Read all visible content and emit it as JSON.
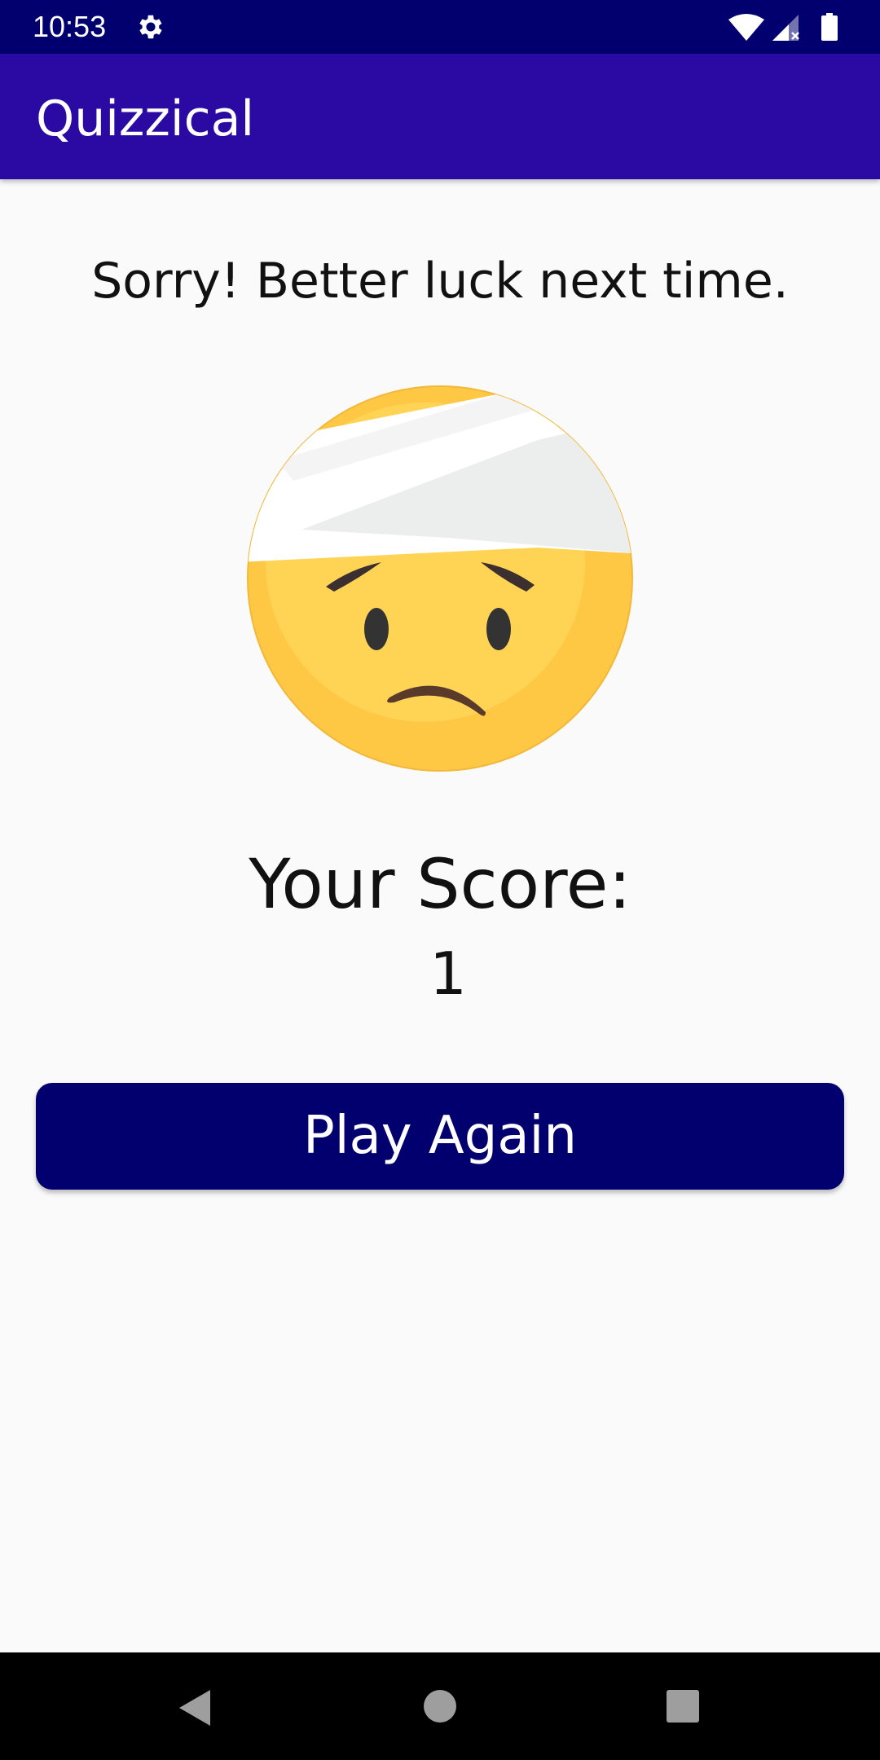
{
  "status_bar": {
    "time": "10:53",
    "icons": [
      "gear-icon",
      "wifi-icon",
      "signal-icon",
      "battery-icon"
    ]
  },
  "app_bar": {
    "title": "Quizzical"
  },
  "result": {
    "message": "Sorry! Better luck next time.",
    "emoji": "face-with-head-bandage-icon",
    "score_label": "Your Score:",
    "score_value": "1"
  },
  "actions": {
    "play_again_label": "Play Again"
  },
  "navigation": {
    "icons": [
      "back-icon",
      "home-icon",
      "recents-icon"
    ]
  },
  "colors": {
    "status_bar": "#01006e",
    "app_bar": "#2a0aa2",
    "button": "#01006e",
    "background": "#fafafa"
  }
}
